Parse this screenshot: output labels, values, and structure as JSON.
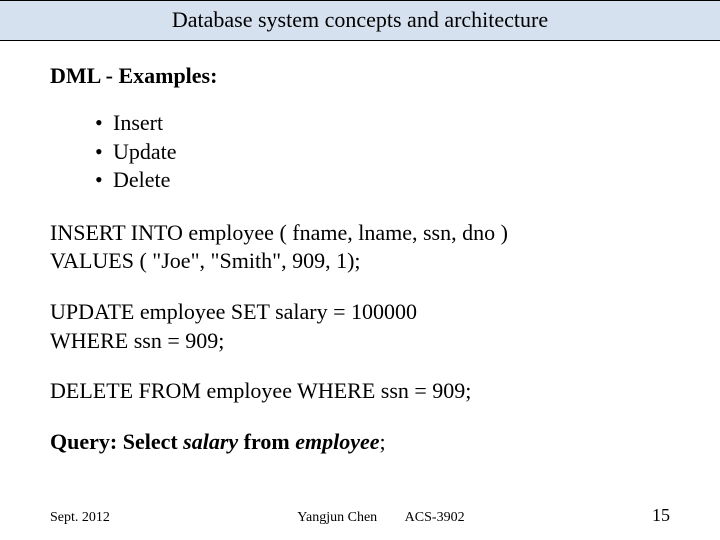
{
  "title": "Database system concepts and architecture",
  "heading": "DML - Examples:",
  "bullets": [
    "Insert",
    "Update",
    "Delete"
  ],
  "sql": {
    "insert_l1": "INSERT INTO employee ( fname, lname, ssn, dno )",
    "insert_l2": "VALUES ( \"Joe\", \"Smith\", 909, 1);",
    "update_l1": "UPDATE employee SET salary = 100000",
    "update_l2": "WHERE ssn = 909;",
    "delete_l1": "DELETE FROM employee WHERE ssn = 909;"
  },
  "query": {
    "label": "Query:",
    "w_select": "Select",
    "w_salary": "salary",
    "w_from": "from",
    "w_employee": "employee",
    "tail": ";"
  },
  "footer": {
    "date": "Sept. 2012",
    "author": "Yangjun Chen",
    "course": "ACS-3902",
    "page": "15"
  }
}
